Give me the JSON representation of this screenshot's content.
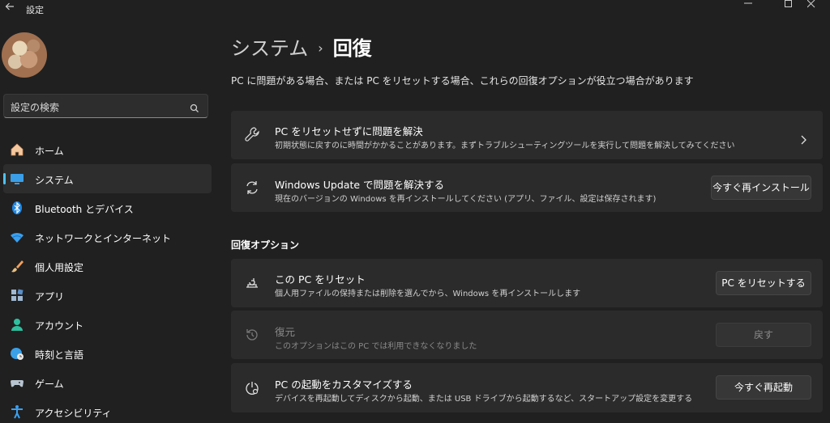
{
  "window": {
    "title": "設定"
  },
  "sidebar": {
    "search": {
      "placeholder": "設定の検索"
    },
    "items": [
      {
        "label": "ホーム",
        "icon": "home-icon"
      },
      {
        "label": "システム",
        "icon": "system-icon",
        "selected": true
      },
      {
        "label": "Bluetooth とデバイス",
        "icon": "bluetooth-icon"
      },
      {
        "label": "ネットワークとインターネット",
        "icon": "wifi-icon"
      },
      {
        "label": "個人用設定",
        "icon": "brush-icon"
      },
      {
        "label": "アプリ",
        "icon": "apps-icon"
      },
      {
        "label": "アカウント",
        "icon": "account-icon"
      },
      {
        "label": "時刻と言語",
        "icon": "globe-clock-icon"
      },
      {
        "label": "ゲーム",
        "icon": "gamepad-icon"
      },
      {
        "label": "アクセシビリティ",
        "icon": "accessibility-icon"
      }
    ]
  },
  "main": {
    "breadcrumb": {
      "parent": "システム",
      "separator": "›",
      "current": "回復"
    },
    "intro": "PC に問題がある場合、または PC をリセットする場合、これらの回復オプションが役立つ場合があります",
    "top_cards": [
      {
        "title": "PC をリセットせずに問題を解決",
        "desc": "初期状態に戻すのに時間がかかることがあります。まずトラブルシューティングツールを実行して問題を解決してみてください",
        "icon": "wrench-icon"
      },
      {
        "title": "Windows Update で問題を解決する",
        "desc": "現在のバージョンの Windows を再インストールしてください (アプリ、ファイル、設定は保存されます)",
        "button": "今すぐ再インストール",
        "icon": "sync-icon"
      }
    ],
    "section_title": "回復オプション",
    "options": [
      {
        "title": "この PC をリセット",
        "desc": "個人用ファイルの保持または削除を選んでから、Windows を再インストールします",
        "button": "PC をリセットする",
        "icon": "reset-pc-icon"
      },
      {
        "title": "復元",
        "desc": "このオプションはこの PC では利用できなくなりました",
        "button": "戻す",
        "icon": "history-icon",
        "disabled": true
      },
      {
        "title": "PC の起動をカスタマイズする",
        "desc": "デバイスを再起動してディスクから起動、または USB ドライブから起動するなど、スタートアップ設定を変更する",
        "button": "今すぐ再起動",
        "icon": "advanced-startup-icon"
      }
    ]
  },
  "colors": {
    "background": "#202020",
    "card": "#2b2b2b",
    "accent": "#4cc2ff"
  }
}
